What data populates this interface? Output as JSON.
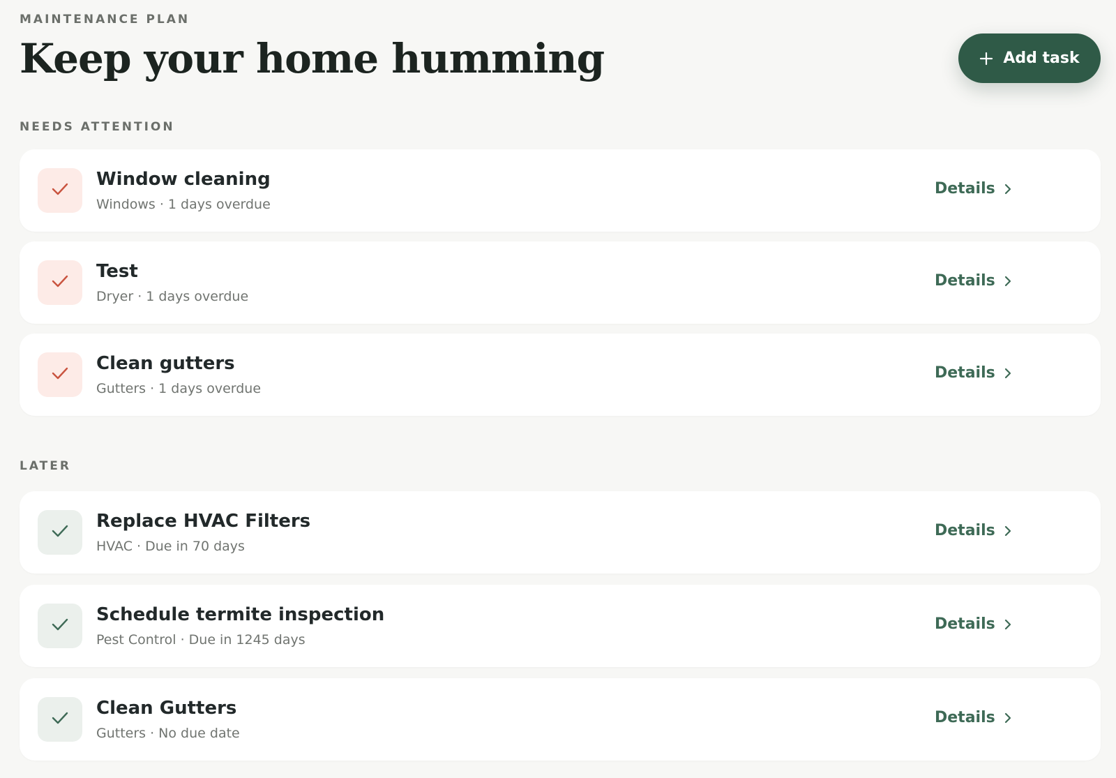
{
  "header": {
    "eyebrow": "MAINTENANCE PLAN",
    "title": "Keep your home humming",
    "add_button_label": "Add task"
  },
  "sections": {
    "needs_attention": {
      "label": "NEEDS ATTENTION",
      "tasks": [
        {
          "title": "Window cleaning",
          "meta": "Windows · 1 days overdue",
          "details_label": "Details"
        },
        {
          "title": "Test",
          "meta": "Dryer · 1 days overdue",
          "details_label": "Details"
        },
        {
          "title": "Clean gutters",
          "meta": "Gutters · 1 days overdue",
          "details_label": "Details"
        }
      ]
    },
    "later": {
      "label": "LATER",
      "tasks": [
        {
          "title": "Replace HVAC Filters",
          "meta": "HVAC · Due in 70 days",
          "details_label": "Details"
        },
        {
          "title": "Schedule termite inspection",
          "meta": "Pest Control · Due in 1245 days",
          "details_label": "Details"
        },
        {
          "title": "Clean Gutters",
          "meta": "Gutters · No due date",
          "details_label": "Details"
        }
      ]
    }
  },
  "icons": {
    "add": "plus-icon",
    "check": "check-icon",
    "details": "chevron-right-icon"
  },
  "colors": {
    "accent": "#2f5a47",
    "overdue_check": "#c9533f",
    "overdue_bg": "#fdebe7",
    "later_check": "#3e6a56",
    "later_bg": "#ebf0ec"
  }
}
